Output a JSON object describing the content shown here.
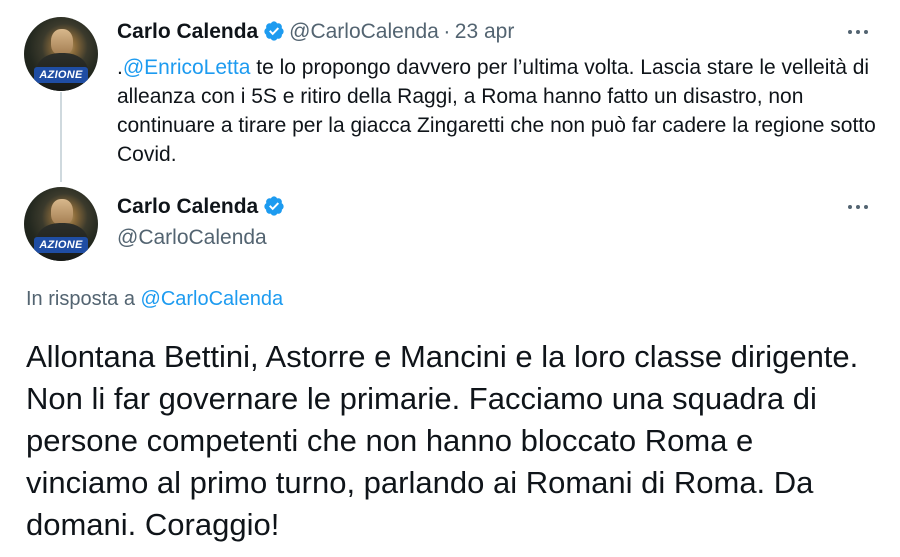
{
  "tweet1": {
    "avatar_label": "AZIONE",
    "name": "Carlo Calenda",
    "handle": "@CarloCalenda",
    "separator": "·",
    "date": "23 apr",
    "text_prefix": ".",
    "mention": "@EnricoLetta",
    "text": " te lo propongo davvero per l’ultima volta. Lascia stare le velleità di alleanza con i 5S e ritiro della Raggi, a Roma hanno fatto un disastro, non continuare a tirare per la giacca Zingaretti che non può far cadere la regione sotto Covid."
  },
  "tweet2": {
    "avatar_label": "AZIONE",
    "name": "Carlo Calenda",
    "handle": "@CarloCalenda",
    "reply_prefix": "In risposta a",
    "reply_to": "@CarloCalenda",
    "text": "Allontana Bettini, Astorre e Mancini e la loro classe dirigente. Non li far governare le primarie. Facciamo una squadra di persone competenti che non hanno bloccato Roma e vinciamo al primo turno, parlando ai Romani di Roma. Da domani. Coraggio!"
  },
  "icons": {
    "verified": "verified-badge-icon",
    "more": "more-options-icon"
  },
  "colors": {
    "link": "#1d9bf0",
    "secondary_text": "#536471",
    "primary_text": "#0f1419",
    "thread_line": "#cfd9de"
  }
}
